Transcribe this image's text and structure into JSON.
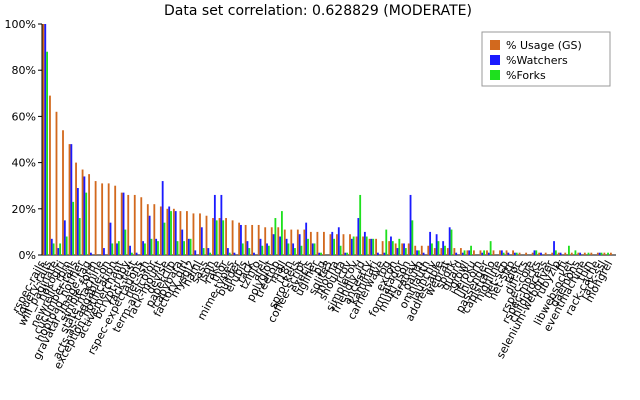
{
  "chart_data": {
    "type": "bar",
    "title": "Data set correlation: 0.628829 (MODERATE)",
    "ylim": [
      0,
      100
    ],
    "y_ticks": [
      "0%",
      "20%",
      "40%",
      "60%",
      "80%",
      "100%"
    ],
    "y_tick_values": [
      0,
      20,
      40,
      60,
      80,
      100
    ],
    "legend_position": "top-right",
    "series": [
      {
        "name": "% Usage (GS)",
        "color": "#d2691e"
      },
      {
        "name": "%Watchers",
        "color": "#1a1aff"
      },
      {
        "name": "%Forks",
        "color": "#1ee01e"
      }
    ],
    "categories": [
      "rspec-rails",
      "jquery-rails",
      "will_paginate",
      "nokogiri",
      "newrelic_rpm",
      "cucumber-rails",
      "hoptoad_notifier",
      "gravatar_image_tag",
      "simple_form",
      "state_machine",
      "acts-as-taggable-on",
      "exception_notification",
      "activemerchant",
      "bcrypt-ruby",
      "rack-test",
      "rspec-expectations",
      "net-ssh",
      "term-ansicolor",
      "rack-mount",
      "devise",
      "paperclip",
      "capybara",
      "factory_girl",
      "mysql2",
      "haml",
      "sass",
      "json",
      "rake",
      "thor",
      "mime-types",
      "builder",
      "erubis",
      "rack",
      "tzinfo",
      "arel",
      "polyglot",
      "treetop",
      "mail",
      "i18n",
      "sprockets",
      "coffee-script",
      "execjs",
      "uglifier",
      "pg",
      "sqlite3",
      "mocha",
      "shoulda",
      "rcov",
      "simplecov",
      "friendly_id",
      "ancestry",
      "kaminari",
      "carrierwave",
      "fog",
      "excon",
      "formatador",
      "multi_json",
      "faraday",
      "oauth",
      "omniauth",
      "launchy",
      "addressable",
      "webrat",
      "spork",
      "guard",
      "growl",
      "heroku",
      "unicorn",
      "passenger",
      "capistrano",
      "highline",
      "net-scp",
      "net-sftp",
      "rdoc",
      "diff-lcs",
      "rspec-core",
      "rspec-mocks",
      "childprocess",
      "selenium-webdriver",
      "rubyzip",
      "ffi",
      "libwebsocket",
      "daemons",
      "eventmachine",
      "thin",
      "rack-cache",
      "rack-ssl",
      "mongrel"
    ],
    "usage": [
      100,
      69,
      62,
      54,
      48,
      40,
      37,
      35,
      32,
      31,
      31,
      30,
      27,
      26,
      26,
      25,
      22,
      22,
      21,
      20,
      20,
      19,
      19,
      18,
      18,
      17,
      16,
      16,
      16,
      15,
      14,
      13,
      13,
      13,
      12,
      12,
      12,
      11,
      11,
      11,
      11,
      10,
      10,
      10,
      9,
      9,
      9,
      9,
      8,
      8,
      7,
      7,
      6,
      6,
      5,
      5,
      5,
      4,
      4,
      4,
      3,
      3,
      3,
      3,
      3,
      2,
      2,
      2,
      2,
      2,
      2,
      2,
      2,
      1,
      1,
      1,
      1,
      1,
      1,
      1,
      1,
      1,
      1,
      1,
      1,
      1,
      1,
      1
    ],
    "watchers": [
      100,
      7,
      3,
      15,
      48,
      29,
      34,
      1,
      0,
      3,
      14,
      5,
      27,
      4,
      1,
      6,
      17,
      7,
      32,
      21,
      19,
      11,
      7,
      2,
      12,
      3,
      26,
      26,
      3,
      1,
      13,
      6,
      1,
      7,
      5,
      9,
      8,
      7,
      5,
      9,
      14,
      5,
      1,
      0,
      10,
      12,
      1,
      7,
      16,
      10,
      7,
      1,
      1,
      8,
      3,
      5,
      26,
      2,
      1,
      10,
      9,
      6,
      12,
      1,
      1,
      2,
      0,
      1,
      1,
      0,
      2,
      1,
      1,
      0,
      0,
      2,
      1,
      0,
      6,
      1,
      0,
      0,
      1,
      0,
      0,
      1,
      0,
      0
    ],
    "forks": [
      88,
      5,
      5,
      8,
      23,
      16,
      27,
      0,
      0,
      0,
      5,
      6,
      11,
      1,
      0,
      5,
      7,
      6,
      14,
      19,
      6,
      6,
      7,
      0,
      3,
      1,
      15,
      15,
      1,
      0,
      5,
      3,
      0,
      4,
      4,
      16,
      19,
      5,
      3,
      4,
      7,
      5,
      1,
      0,
      7,
      4,
      1,
      8,
      26,
      8,
      7,
      0,
      11,
      6,
      7,
      3,
      15,
      2,
      0,
      5,
      6,
      4,
      11,
      0,
      2,
      4,
      0,
      2,
      6,
      0,
      1,
      0,
      1,
      0,
      0,
      2,
      0,
      0,
      2,
      0,
      4,
      2,
      0,
      1,
      0,
      1,
      1,
      0
    ],
    "labeled_every": 1
  }
}
